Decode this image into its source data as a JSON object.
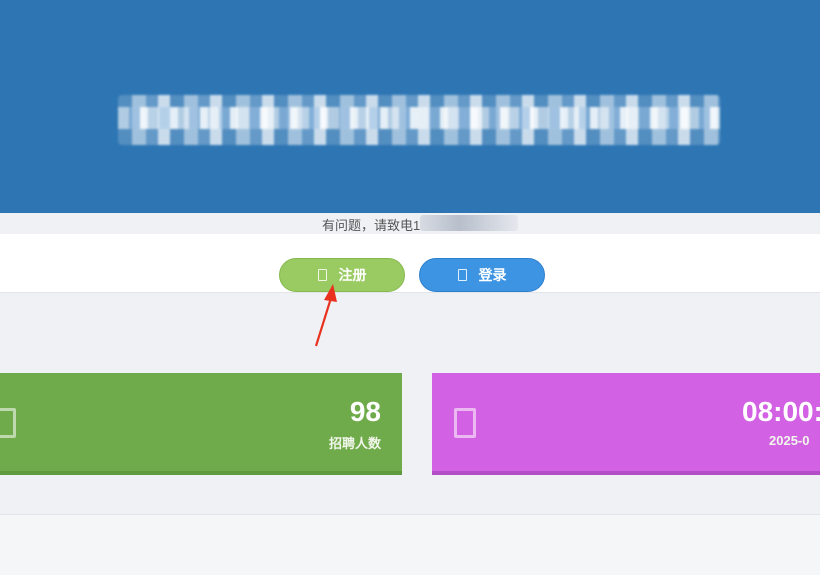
{
  "contact": {
    "text": "有问题，请致电1"
  },
  "auth": {
    "register_label": "注册",
    "login_label": "登录"
  },
  "cards": [
    {
      "value": "98",
      "label": "招聘人数",
      "icon": "document-icon",
      "color": "#70ab4b"
    },
    {
      "value": "08:00:",
      "label": "2025-0",
      "icon": "document-icon",
      "color": "#d262e3"
    }
  ],
  "colors": {
    "banner": "#2e76b3",
    "register": "#9acb62",
    "login": "#3d94e3",
    "arrow": "#e8321f"
  }
}
